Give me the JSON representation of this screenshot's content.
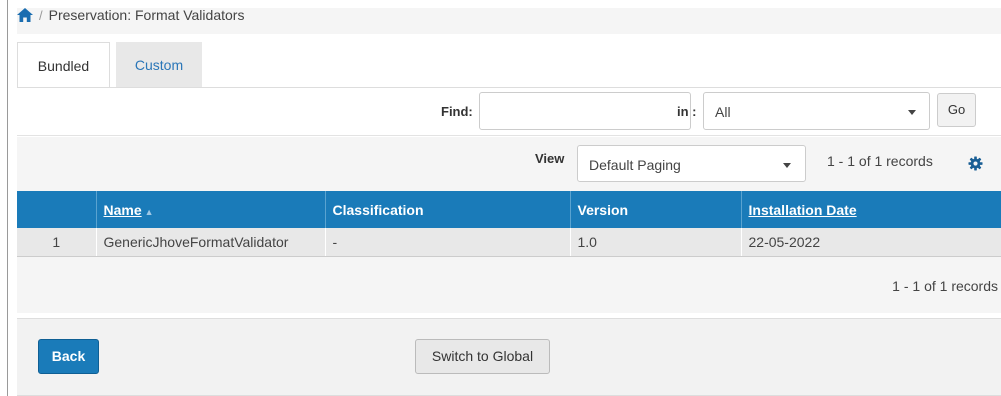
{
  "breadcrumb": {
    "separator": "/",
    "current": "Preservation: Format Validators"
  },
  "tabs": [
    {
      "label": "Bundled",
      "active": true
    },
    {
      "label": "Custom",
      "active": false
    }
  ],
  "find": {
    "label": "Find:",
    "value": "",
    "in_label": "in :",
    "in_selected": "All",
    "go_label": "Go"
  },
  "view": {
    "label": "View",
    "selected": "Default Paging",
    "records_summary": "1 - 1 of 1 records"
  },
  "table": {
    "columns": [
      {
        "label": "",
        "sortable": false
      },
      {
        "label": "Name",
        "sortable": true,
        "sorted": "asc"
      },
      {
        "label": "Classification",
        "sortable": false
      },
      {
        "label": "Version",
        "sortable": false
      },
      {
        "label": "Installation Date",
        "sortable": true
      }
    ],
    "rows": [
      {
        "index": "1",
        "name": "GenericJhoveFormatValidator",
        "classification": "-",
        "version": "1.0",
        "installation_date": "22-05-2022"
      }
    ]
  },
  "footer": {
    "records_summary": "1 - 1 of 1 records"
  },
  "actions": {
    "back_label": "Back",
    "switch_label": "Switch to Global"
  },
  "colors": {
    "primary": "#1a7bb9",
    "tab_link": "#2a76b8",
    "header_text": "#ffffff"
  },
  "icons": {
    "home": "home-icon",
    "gear": "gear-icon",
    "sort": "sort-asc-icon",
    "caret": "chevron-down-icon"
  }
}
